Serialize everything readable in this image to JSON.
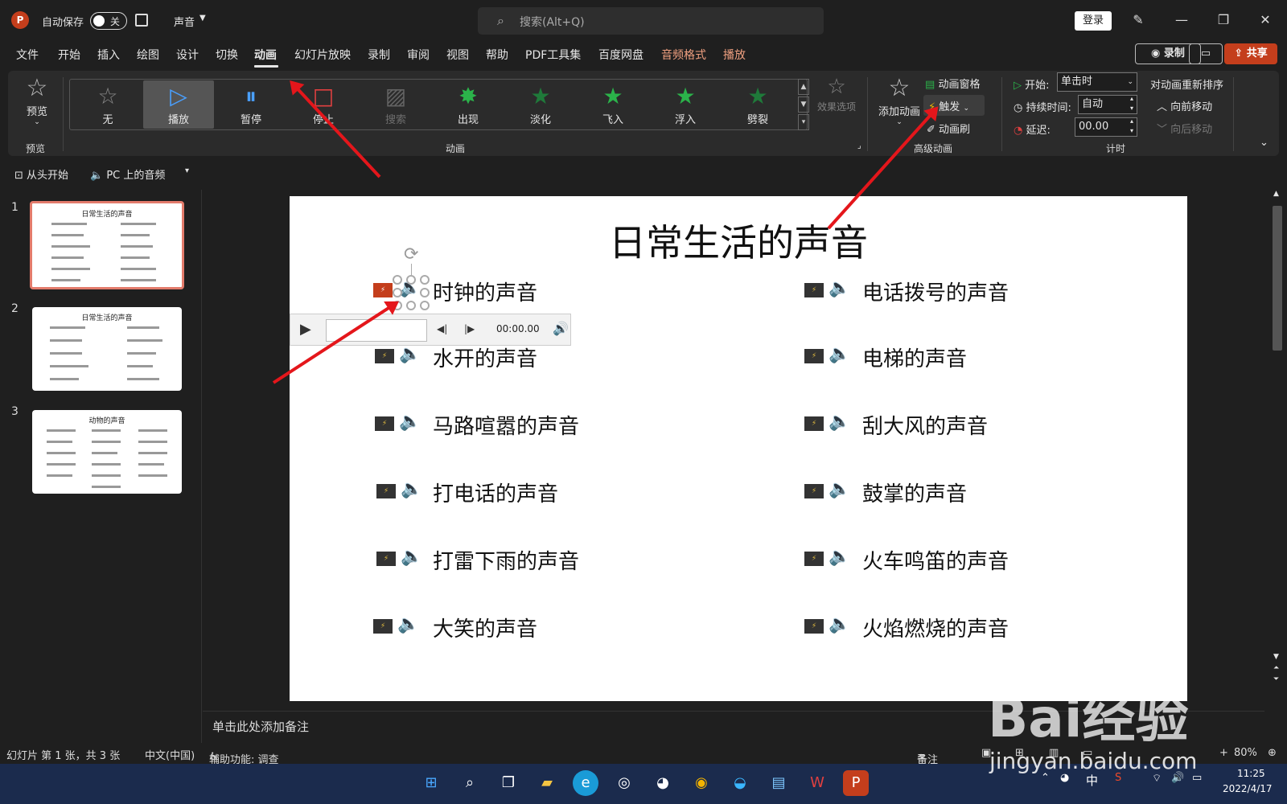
{
  "titlebar": {
    "autosave_label": "自动保存",
    "autosave_state": "关",
    "doc_name": "声音",
    "search_placeholder": "搜索(Alt+Q)",
    "login": "登录"
  },
  "menu": {
    "tabs": [
      "文件",
      "开始",
      "插入",
      "绘图",
      "设计",
      "切换",
      "动画",
      "幻灯片放映",
      "录制",
      "审阅",
      "视图",
      "帮助",
      "PDF工具集",
      "百度网盘",
      "音频格式",
      "播放"
    ],
    "active": "动画",
    "record_btn": "录制",
    "share_btn": "共享"
  },
  "ribbon": {
    "preview_label": "预览",
    "preview_group": "预览",
    "animations": [
      {
        "label": "无",
        "glyph": "☆"
      },
      {
        "label": "播放",
        "glyph": "▷"
      },
      {
        "label": "暂停",
        "glyph": "⏸"
      },
      {
        "label": "停止",
        "glyph": "□"
      },
      {
        "label": "搜索",
        "glyph": "▨"
      },
      {
        "label": "出现",
        "glyph": "✸"
      },
      {
        "label": "淡化",
        "glyph": "★"
      },
      {
        "label": "飞入",
        "glyph": "★"
      },
      {
        "label": "浮入",
        "glyph": "★"
      },
      {
        "label": "劈裂",
        "glyph": "★"
      }
    ],
    "anim_group": "动画",
    "effect_options": "效果选项",
    "add_animation": "添加动画",
    "animation_pane": "动画窗格",
    "trigger": "触发",
    "animation_painter": "动画刷",
    "advanced_group": "高级动画",
    "start_label": "开始:",
    "start_value": "单击时",
    "duration_label": "持续时间:",
    "duration_value": "自动",
    "delay_label": "延迟:",
    "delay_value": "00.00",
    "reorder_title": "对动画重新排序",
    "move_earlier": "向前移动",
    "move_later": "向后移动",
    "timing_group": "计时"
  },
  "quick_access": {
    "from_start": "从头开始",
    "audio_pc": "PC 上的音频"
  },
  "thumbnails": [
    {
      "num": "1",
      "title": "日常生活的声音"
    },
    {
      "num": "2",
      "title": "日常生活的声音"
    },
    {
      "num": "3",
      "title": "动物的声音"
    }
  ],
  "slide": {
    "title": "日常生活的声音",
    "left_items": [
      "时钟的声音",
      "水开的声音",
      "马路喧嚣的声音",
      "打电话的声音",
      "打雷下雨的声音",
      "大笑的声音"
    ],
    "right_items": [
      "电话拨号的声音",
      "电梯的声音",
      "刮大风的声音",
      "鼓掌的声音",
      "火车鸣笛的声音",
      "火焰燃烧的声音"
    ],
    "player_time": "00:00.00"
  },
  "notes": {
    "placeholder": "单击此处添加备注"
  },
  "status": {
    "slide_info": "幻灯片 第 1 张，共 3 张",
    "language": "中文(中国)",
    "accessibility": "辅助功能: 调查",
    "notes_btn": "备注",
    "zoom": "80%"
  },
  "taskbar": {
    "ime": "中",
    "time": "11:25",
    "date": "2022/4/17"
  },
  "watermark": {
    "brand": "Bai经验",
    "url": "jingyan.baidu.com"
  },
  "colors": {
    "accent": "#c43e1c",
    "annotation_arrow": "#e4161b",
    "star_green": "#2bb34a"
  }
}
